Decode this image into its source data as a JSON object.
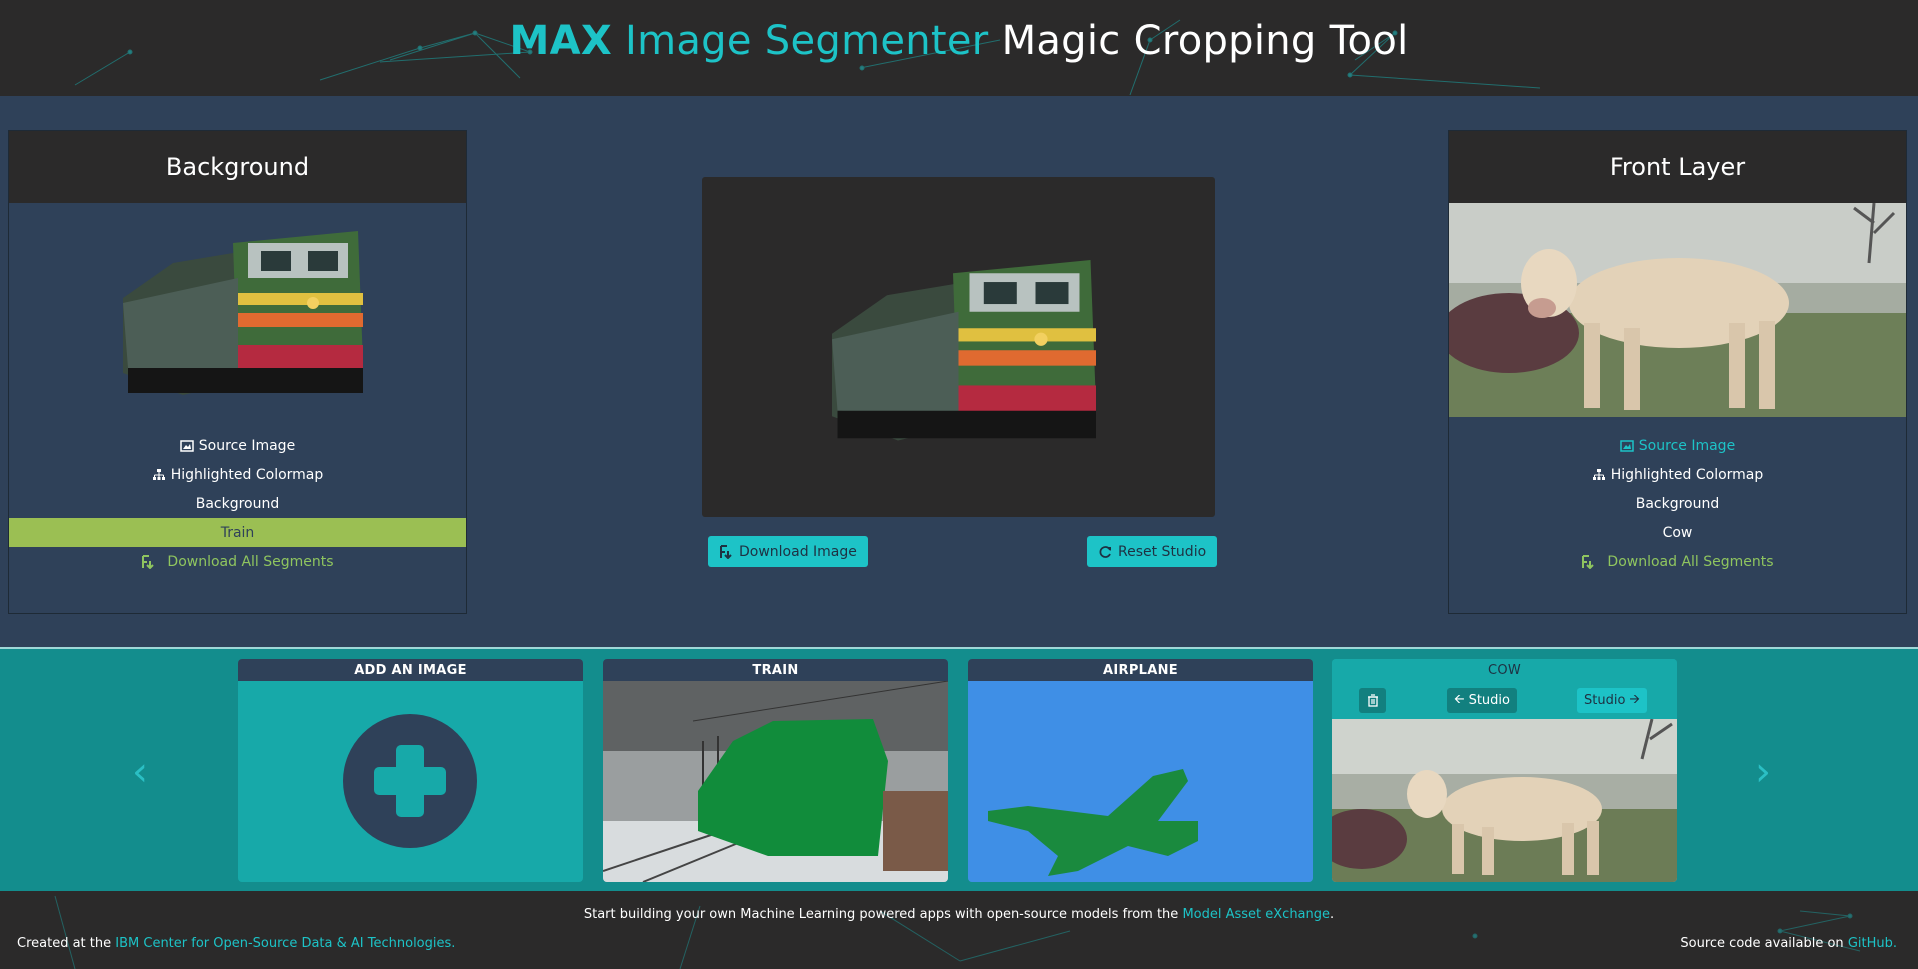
{
  "header": {
    "title_part1": "MAX",
    "title_part2": "Image Segmenter",
    "title_part3": "Magic Cropping Tool"
  },
  "left_panel": {
    "title": "Background",
    "options": [
      {
        "label": "Source Image",
        "icon": "image-icon"
      },
      {
        "label": "Highlighted Colormap",
        "icon": "sitemap-icon"
      },
      {
        "label": "Background",
        "icon": ""
      },
      {
        "label": "Train",
        "icon": "",
        "selected": true
      }
    ],
    "download_label": "Download All Segments"
  },
  "right_panel": {
    "title": "Front Layer",
    "options": [
      {
        "label": "Source Image",
        "icon": "image-icon",
        "active": true
      },
      {
        "label": "Highlighted Colormap",
        "icon": "sitemap-icon"
      },
      {
        "label": "Background",
        "icon": ""
      },
      {
        "label": "Cow",
        "icon": ""
      }
    ],
    "download_label": "Download All Segments"
  },
  "stage": {
    "download_button": "Download Image",
    "reset_button": "Reset Studio"
  },
  "gallery": {
    "prev_icon": "chevron-left-icon",
    "next_icon": "chevron-right-icon",
    "cards": [
      {
        "title": "ADD AN IMAGE"
      },
      {
        "title": "TRAIN"
      },
      {
        "title": "AIRPLANE"
      },
      {
        "title": "COW",
        "selected": true,
        "studio_left": "Studio",
        "studio_right": "Studio"
      }
    ]
  },
  "footer": {
    "center_text": "Start building your own Machine Learning powered apps with open-source models from the",
    "center_link": "Model Asset eXchange",
    "center_end": ".",
    "left_text": "Created at the",
    "left_link": "IBM Center for Open-Source Data & AI Technologies.",
    "right_text": "Source code available on",
    "right_link": "GitHub."
  },
  "colors": {
    "accent": "#1dc3c7",
    "panel": "#2f4159",
    "dark": "#2b2a2a",
    "selected": "#9bbf53",
    "strip": "#138d8d"
  }
}
